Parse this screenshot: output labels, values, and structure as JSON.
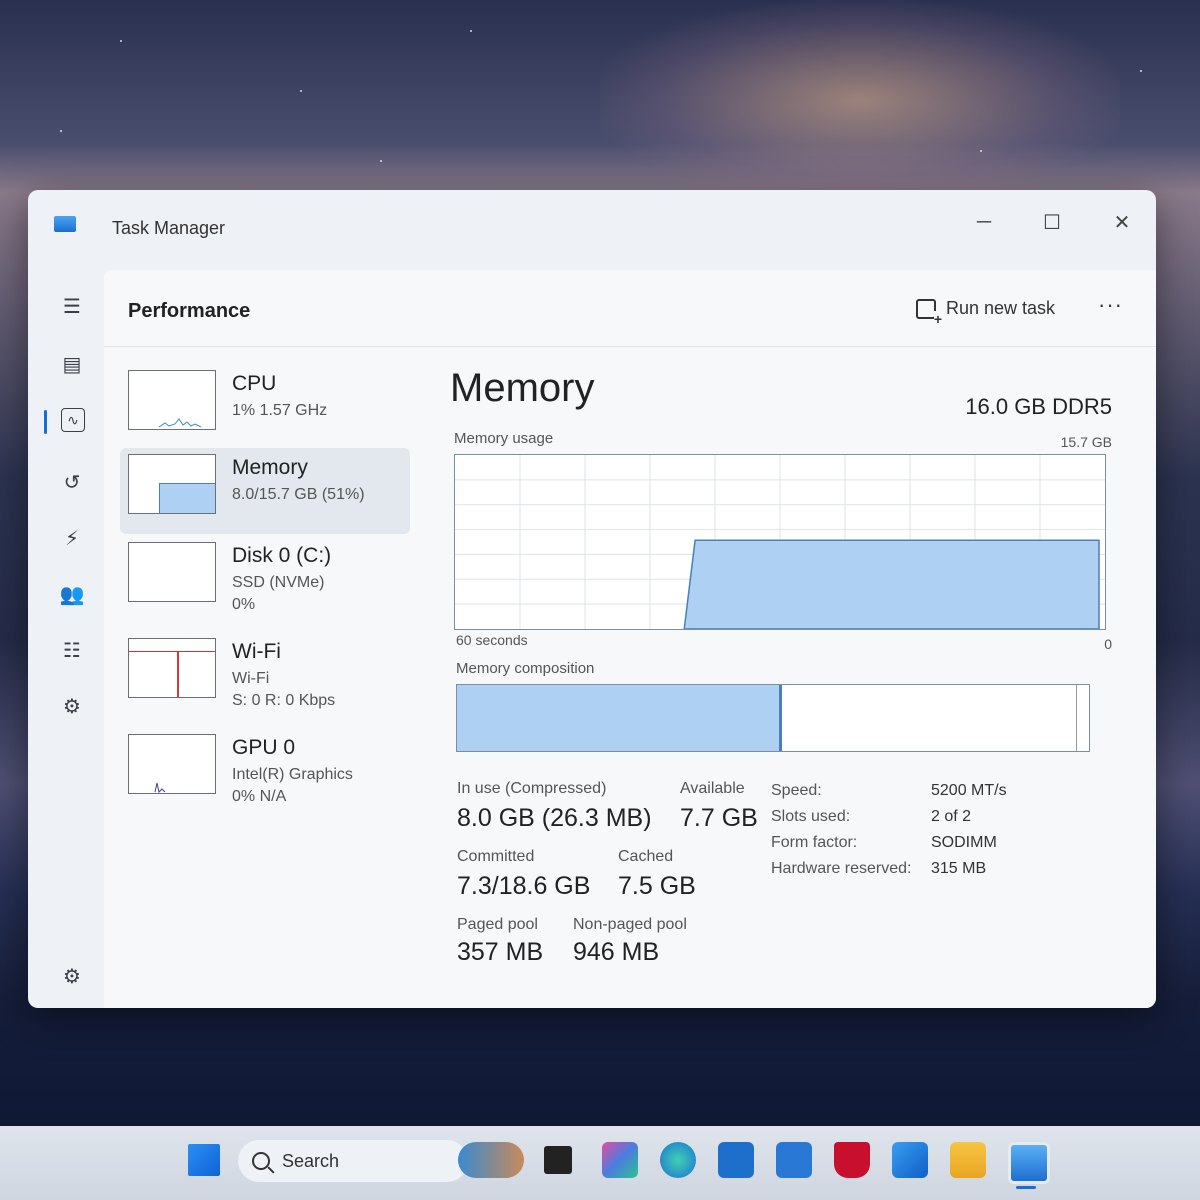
{
  "window": {
    "title": "Task Manager",
    "minimize": "─",
    "maximize": "☐",
    "close": "✕"
  },
  "header": {
    "title": "Performance",
    "run_new_task": "Run new task",
    "more": "···"
  },
  "resources": [
    {
      "name": "CPU",
      "sub": "1% 1.57 GHz",
      "sub2": ""
    },
    {
      "name": "Memory",
      "sub": "8.0/15.7 GB (51%)",
      "sub2": ""
    },
    {
      "name": "Disk 0 (C:)",
      "sub": "SSD (NVMe)",
      "sub2": "0%"
    },
    {
      "name": "Wi-Fi",
      "sub": "Wi-Fi",
      "sub2": "S: 0 R: 0 Kbps"
    },
    {
      "name": "GPU 0",
      "sub": "Intel(R) Graphics",
      "sub2": "0% N/A"
    }
  ],
  "memory": {
    "title": "Memory",
    "spec": "16.0 GB DDR5",
    "usage_label": "Memory usage",
    "usage_max": "15.7 GB",
    "time_left": "60 seconds",
    "time_right": "0",
    "composition_label": "Memory composition",
    "usage_history_pct": [
      0,
      0,
      0,
      0,
      0,
      0,
      0,
      0,
      0,
      0,
      0,
      0,
      0,
      0,
      0,
      0,
      0,
      0,
      0,
      0,
      0,
      0,
      51,
      51,
      51,
      51,
      51,
      51,
      51,
      51,
      51,
      51,
      51,
      51,
      51,
      51,
      51,
      51,
      51,
      51,
      51,
      51,
      51,
      51,
      51,
      51,
      51,
      51,
      51,
      51,
      51,
      51,
      51,
      51,
      51,
      51,
      51,
      51,
      51,
      51
    ],
    "composition": {
      "in_use_fraction": 0.51,
      "modified_fraction": 0.005,
      "standby_fraction": 0.465,
      "free_fraction": 0.02
    },
    "stats": {
      "in_use_label": "In use (Compressed)",
      "in_use_value": "8.0 GB (26.3 MB)",
      "available_label": "Available",
      "available_value": "7.7 GB",
      "committed_label": "Committed",
      "committed_value": "7.3/18.6 GB",
      "cached_label": "Cached",
      "cached_value": "7.5 GB",
      "paged_label": "Paged pool",
      "paged_value": "357 MB",
      "nonpaged_label": "Non-paged pool",
      "nonpaged_value": "946 MB"
    },
    "details": [
      {
        "key": "Speed:",
        "value": "5200 MT/s"
      },
      {
        "key": "Slots used:",
        "value": "2 of 2"
      },
      {
        "key": "Form factor:",
        "value": "SODIMM"
      },
      {
        "key": "Hardware reserved:",
        "value": "315 MB"
      }
    ]
  },
  "taskbar": {
    "search_label": "Search"
  },
  "colors": {
    "accent": "#1a6dd8",
    "memory_fill": "#aed0f2",
    "memory_line": "#4a7fb8",
    "wifi_spike": "#d33b3b"
  }
}
